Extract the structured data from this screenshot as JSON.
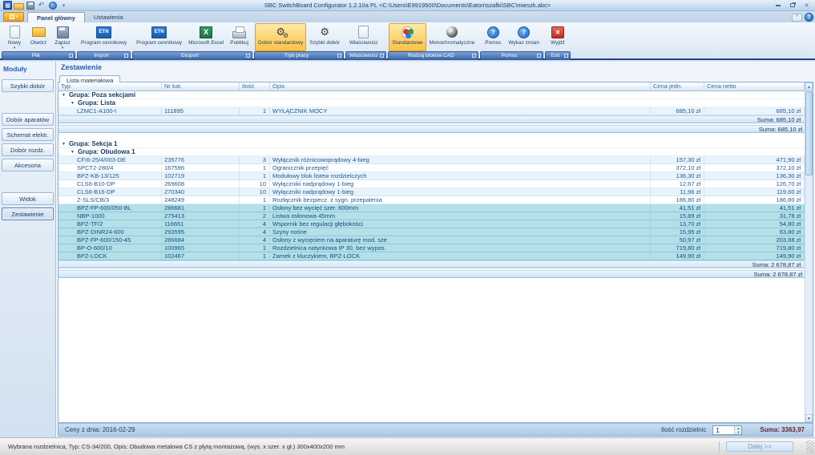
{
  "window": {
    "title": "SBC SwitchBoard Configurator 1.2.10a PL  <C:\\Users\\E9919500\\Documents\\Eaton\\szafki\\SBC\\mieszk.abc>"
  },
  "tabs": [
    {
      "label": "Panel główny",
      "active": true
    },
    {
      "label": "Ustawienia",
      "active": false
    }
  ],
  "ribbon": {
    "groups": [
      {
        "label": "Plik",
        "buttons": [
          {
            "label": "Nowy",
            "icon": "new",
            "dropdown": true
          },
          {
            "label": "Otwórz",
            "icon": "open"
          },
          {
            "label": "Zapisz",
            "icon": "save",
            "dropdown": true
          }
        ]
      },
      {
        "label": "Import",
        "buttons": [
          {
            "label": "Program cennikowy",
            "icon": "etn"
          }
        ]
      },
      {
        "label": "Eksport",
        "buttons": [
          {
            "label": "Program cennikowy",
            "icon": "etn"
          },
          {
            "label": "Microsoft Excel",
            "icon": "excel"
          },
          {
            "label": "Publikuj",
            "icon": "print"
          }
        ]
      },
      {
        "label": "Tryb pracy",
        "buttons": [
          {
            "label": "Dobór standardowy",
            "icon": "gears",
            "active": true
          },
          {
            "label": "Szybki dobór",
            "icon": "gear"
          }
        ]
      },
      {
        "label": "Właściwości",
        "buttons": [
          {
            "label": "Właściwości",
            "icon": "doc"
          }
        ]
      },
      {
        "label": "Rodzaj bloków CAD",
        "buttons": [
          {
            "label": "Standardowe",
            "icon": "rgb",
            "active": true
          },
          {
            "label": "Monochromatyczne",
            "icon": "mono"
          }
        ]
      },
      {
        "label": "Pomoc",
        "buttons": [
          {
            "label": "Pomoc",
            "icon": "help"
          },
          {
            "label": "Wykaz zmian",
            "icon": "help"
          }
        ]
      },
      {
        "label": "Exit",
        "buttons": [
          {
            "label": "Wyjdź",
            "icon": "exit"
          }
        ]
      }
    ]
  },
  "sidebar": {
    "header": "Moduły",
    "items": [
      {
        "label": "Szybki dobór",
        "gap": 6
      },
      {
        "label": "Dobór aparatów",
        "gap": 26
      },
      {
        "label": "Schemat elektr.",
        "gap": 3
      },
      {
        "label": "Dobór rozdz.",
        "gap": 3
      },
      {
        "label": "Akcesoria",
        "gap": 3
      },
      {
        "label": "Widok",
        "gap": 26
      },
      {
        "label": "Zestawienie",
        "gap": 3,
        "selected": true
      }
    ]
  },
  "main": {
    "title": "Zestawienie",
    "doc_tab": "Lista materiałowa",
    "table": {
      "columns": [
        "Typ",
        "Nr kat.",
        "Ilość",
        "Opis",
        "Cena jedn.",
        "Cena netto"
      ],
      "rows": [
        {
          "kind": "group",
          "indent": 0,
          "label": "Grupa: Poza sekcjami"
        },
        {
          "kind": "group",
          "indent": 1,
          "label": "Grupa: Lista"
        },
        {
          "kind": "item",
          "typ": "LZMC1-A100-I",
          "nr_kat": "111895",
          "ilosc": "1",
          "opis": "WYŁĄCZNIK MOCY",
          "cena_jedn": "685,10 zł",
          "cena_netto": "685,10 zł",
          "selected": false
        },
        {
          "kind": "sum",
          "label": "Suma: 685,10 zł"
        },
        {
          "kind": "sum2",
          "label": "Suma: 685,10 zł"
        },
        {
          "kind": "spacer"
        },
        {
          "kind": "group",
          "indent": 0,
          "label": "Grupa: Sekcja 1"
        },
        {
          "kind": "group",
          "indent": 1,
          "label": "Grupa: Obudowa 1"
        },
        {
          "kind": "item",
          "typ": "CFI6-25/4/003-DE",
          "nr_kat": "235776",
          "ilosc": "3",
          "opis": "Wyłącznik różnicowoprądowy 4-bieg",
          "cena_jedn": "157,30 zł",
          "cena_netto": "471,90 zł",
          "selected": false
        },
        {
          "kind": "item",
          "typ": "SPCT2-280/4",
          "nr_kat": "167596",
          "ilosc": "1",
          "opis": "Ogranicznik przepięć",
          "cena_jedn": "372,10 zł",
          "cena_netto": "372,10 zł",
          "selected": false
        },
        {
          "kind": "item",
          "typ": "BPZ-KB-13/125",
          "nr_kat": "102719",
          "ilosc": "1",
          "opis": "Modułowy blok listew rozdzielczych",
          "cena_jedn": "136,30 zł",
          "cena_netto": "136,30 zł",
          "selected": false
        },
        {
          "kind": "item",
          "typ": "CLS6-B10-DP",
          "nr_kat": "269608",
          "ilosc": "10",
          "opis": "Wyłączniki nadprądowy 1-bieg",
          "cena_jedn": "12,67 zł",
          "cena_netto": "126,70 zł",
          "selected": false
        },
        {
          "kind": "item",
          "typ": "CLS6-B16-DP",
          "nr_kat": "270340",
          "ilosc": "10",
          "opis": "Wyłączniki nadprądowy 1-bieg",
          "cena_jedn": "11,96 zł",
          "cena_netto": "119,60 zł",
          "selected": false
        },
        {
          "kind": "item",
          "typ": "Z-SLS/CB/3",
          "nr_kat": "248249",
          "ilosc": "1",
          "opis": "Rozłącznik bezpiecz. z sygn. przepalenia",
          "cena_jedn": "186,80 zł",
          "cena_netto": "186,80 zł",
          "selected": false
        },
        {
          "kind": "item",
          "typ": "BPZ-FP-600/050-BL",
          "nr_kat": "286681",
          "ilosc": "1",
          "opis": "Osłony bez wycięć szer. 600mm",
          "cena_jedn": "41,51 zł",
          "cena_netto": "41,51 zł",
          "selected": true
        },
        {
          "kind": "item",
          "typ": "NBP-1000",
          "nr_kat": "275413",
          "ilosc": "2",
          "opis": "Listwa osłonowa 45mm",
          "cena_jedn": "15,89 zł",
          "cena_netto": "31,78 zł",
          "selected": true
        },
        {
          "kind": "item",
          "typ": "BPZ-TF/2",
          "nr_kat": "116651",
          "ilosc": "4",
          "opis": "Wspornik bez regulacji głębokości",
          "cena_jedn": "13,70 zł",
          "cena_netto": "54,80 zł",
          "selected": true
        },
        {
          "kind": "item",
          "typ": "BPZ-DINR24-600",
          "nr_kat": "293595",
          "ilosc": "4",
          "opis": "Szyny nośne",
          "cena_jedn": "15,95 zł",
          "cena_netto": "63,80 zł",
          "selected": true
        },
        {
          "kind": "item",
          "typ": "BPZ-FP-600/150-45",
          "nr_kat": "286684",
          "ilosc": "4",
          "opis": "Osłony z wycięciem na aparaturę mod. sze",
          "cena_jedn": "50,97 zł",
          "cena_netto": "203,88 zł",
          "selected": true
        },
        {
          "kind": "item",
          "typ": "BP-O-600/10",
          "nr_kat": "100965",
          "ilosc": "1",
          "opis": "Rozdzielnica natynkowa IP 30, bez wypos.",
          "cena_jedn": "719,80 zł",
          "cena_netto": "719,80 zł",
          "selected": true
        },
        {
          "kind": "item",
          "typ": "BPZ-LOCK",
          "nr_kat": "102467",
          "ilosc": "1",
          "opis": "Zamek z kluczykiem, BPZ-LOCK",
          "cena_jedn": "149,90 zł",
          "cena_netto": "149,90 zł",
          "selected": true
        },
        {
          "kind": "sum",
          "label": "Suma: 2 678,87 zł"
        },
        {
          "kind": "sum2",
          "label": "Suma: 2 678,87 zł"
        }
      ]
    },
    "footer": {
      "prices_date": "Ceny z dnia: 2016-02-29",
      "qty_label": "Ilość rozdzielnic",
      "qty_value": "1",
      "total": "Suma: 3363,97"
    }
  },
  "next_button": "Dalej >>",
  "status_bar": "Wybrana rozdzielnica, Typ: CS-34/200, Opis: Obudowa metalowa CS z płytą montażową, (wys. x szer. x gł.) 300x400x200 mm",
  "colors": {
    "accent_orange": "#fcc343",
    "selection_cyan": "#b3e0e9",
    "group_bar_blue": "#3c68a8",
    "total_maroon": "#6b2430"
  }
}
